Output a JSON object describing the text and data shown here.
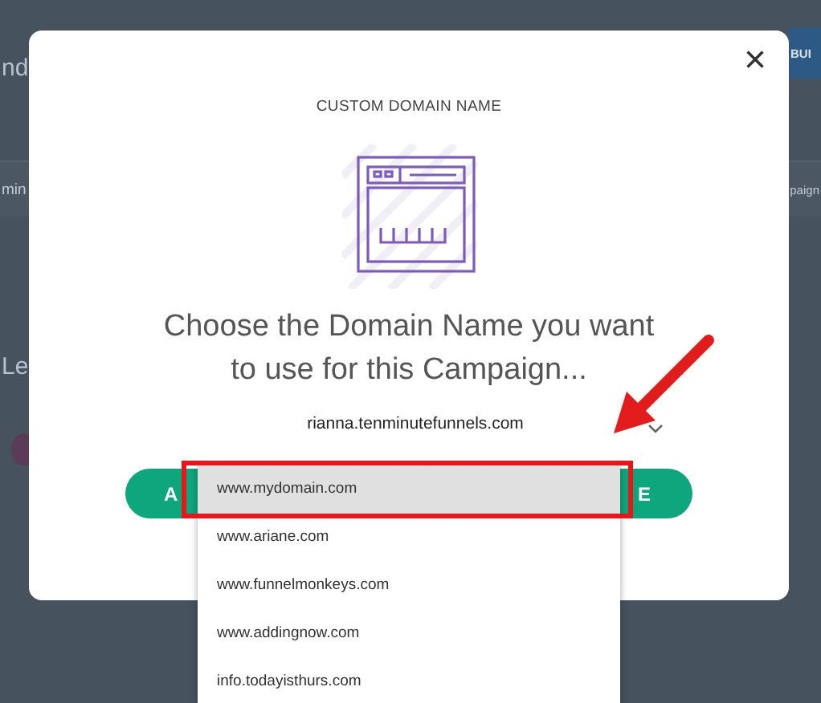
{
  "background_page": {
    "heading_fragment": "nd",
    "build_button": "BUI",
    "tab_left_fragment": "min",
    "tab_right_fragment": "paign",
    "section_fragment": "Le"
  },
  "dialog": {
    "title": "CUSTOM DOMAIN NAME",
    "close_label": "×",
    "prompt": "Choose the Domain Name you want to use for this Campaign...",
    "select": {
      "value": "rianna.tenminutefunnels.com",
      "expanded": true
    },
    "options": [
      {
        "label": "www.mydomain.com",
        "selected": true
      },
      {
        "label": "www.ariane.com",
        "selected": false
      },
      {
        "label": "www.funnelmonkeys.com",
        "selected": false
      },
      {
        "label": "www.addingnow.com",
        "selected": false
      },
      {
        "label": "info.todayisthurs.com",
        "selected": false
      }
    ],
    "action_button": {
      "left_text": "A",
      "right_text": "E"
    }
  }
}
